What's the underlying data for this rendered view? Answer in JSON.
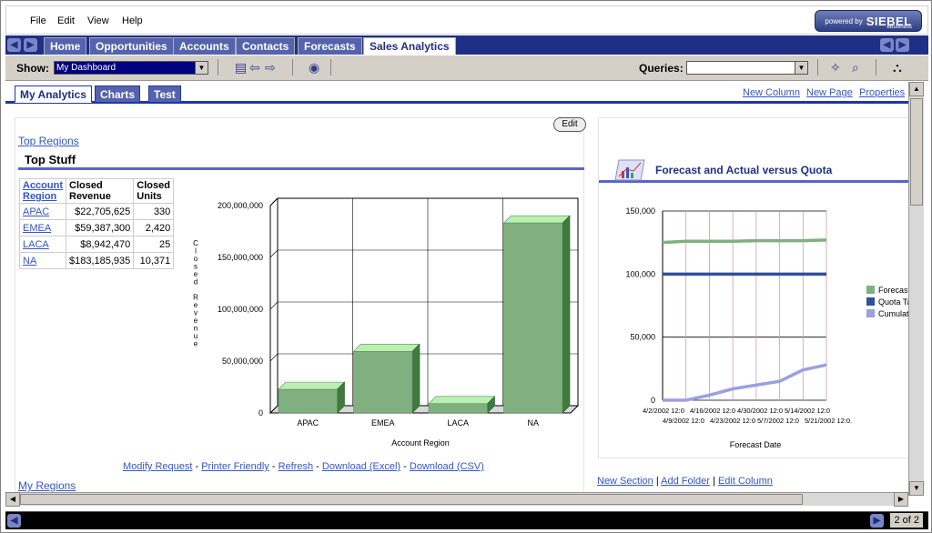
{
  "menu": {
    "file": "File",
    "edit": "Edit",
    "view": "View",
    "help": "Help"
  },
  "badge": {
    "powered_by": "powered by",
    "brand": "SIEBEL",
    "sub": "eBusiness"
  },
  "tabs": [
    {
      "label": "Home"
    },
    {
      "label": "Opportunities"
    },
    {
      "label": "Accounts"
    },
    {
      "label": "Contacts"
    },
    {
      "label": "Forecasts"
    },
    {
      "label": "Sales Analytics"
    }
  ],
  "show": {
    "label": "Show:",
    "value": "My Dashboard"
  },
  "queries": {
    "label": "Queries:",
    "value": ""
  },
  "subtabs": [
    {
      "label": "My Analytics"
    },
    {
      "label": "Charts"
    },
    {
      "label": "Test"
    }
  ],
  "top_links": {
    "new_column": "New Column",
    "new_page": "New Page",
    "properties": "Properties"
  },
  "left_panel": {
    "edit": "Edit",
    "top_regions_link": "Top Regions",
    "section_title": "Top Stuff",
    "table": {
      "headers": [
        "Account Region",
        "Closed Revenue",
        "Closed Units"
      ],
      "rows": [
        [
          "APAC",
          "$22,705,625",
          "330"
        ],
        [
          "EMEA",
          "$59,387,300",
          "2,420"
        ],
        [
          "LACA",
          "$8,942,470",
          "25"
        ],
        [
          "NA",
          "$183,185,935",
          "10,371"
        ]
      ]
    },
    "actions": {
      "modify": "Modify Request",
      "printer": "Printer Friendly",
      "refresh": "Refresh",
      "excel": "Download (Excel)",
      "csv": "Download (CSV)",
      "sep": " - "
    },
    "my_regions_link": "My Regions"
  },
  "right_panel": {
    "title": "Forecast and Actual versus Quota",
    "legend": [
      "Forecast",
      "Quota Ta",
      "Cumulati"
    ]
  },
  "bottom_links": {
    "new_section": "New Section",
    "add_folder": "Add Folder",
    "edit_column": "Edit Column",
    "sep": " | "
  },
  "status": {
    "page": "2 of 2"
  },
  "colors": {
    "nav_blue": "#1f2f85",
    "bar_green": "#80b080",
    "quota_blue": "#2f4fa0",
    "cumulative": "#9aa0e0"
  },
  "chart_data": [
    {
      "type": "bar",
      "title": "",
      "xlabel": "Account Region",
      "ylabel": "Closed Revenue",
      "categories": [
        "APAC",
        "EMEA",
        "LACA",
        "NA"
      ],
      "values": [
        22705625,
        59387300,
        8942470,
        183185935
      ],
      "ylim": [
        0,
        200000000
      ],
      "yticks": [
        "0",
        "50,000,000",
        "100,000,000",
        "150,000,000",
        "200,000,000"
      ],
      "grid": true
    },
    {
      "type": "line",
      "title": "Forecast and Actual versus Quota",
      "xlabel": "Forecast Date",
      "ylabel": "",
      "ylim": [
        0,
        150000
      ],
      "yticks": [
        "0",
        "50,000",
        "100,000",
        "150,000"
      ],
      "x_tick_labels_top": [
        "4/2/2002 12:0",
        "4/16/2002 12:0",
        "4/30/2002 12:0",
        "5/14/2002 12:0"
      ],
      "x_tick_labels_bottom": [
        "4/9/2002 12:0",
        "4/23/2002 12:0",
        "5/7/2002 12:0",
        "5/21/2002 12:0."
      ],
      "x": [
        0,
        1,
        2,
        3,
        4,
        5,
        6,
        7
      ],
      "series": [
        {
          "name": "Forecast",
          "values": [
            125000,
            126000,
            126000,
            126000,
            126500,
            126500,
            126500,
            127000
          ]
        },
        {
          "name": "Quota Ta",
          "values": [
            100000,
            100000,
            100000,
            100000,
            100000,
            100000,
            100000,
            100000
          ]
        },
        {
          "name": "Cumulati",
          "values": [
            0,
            0,
            4000,
            9000,
            12000,
            15000,
            24000,
            28000
          ]
        }
      ],
      "legend": "right",
      "grid": true
    }
  ]
}
